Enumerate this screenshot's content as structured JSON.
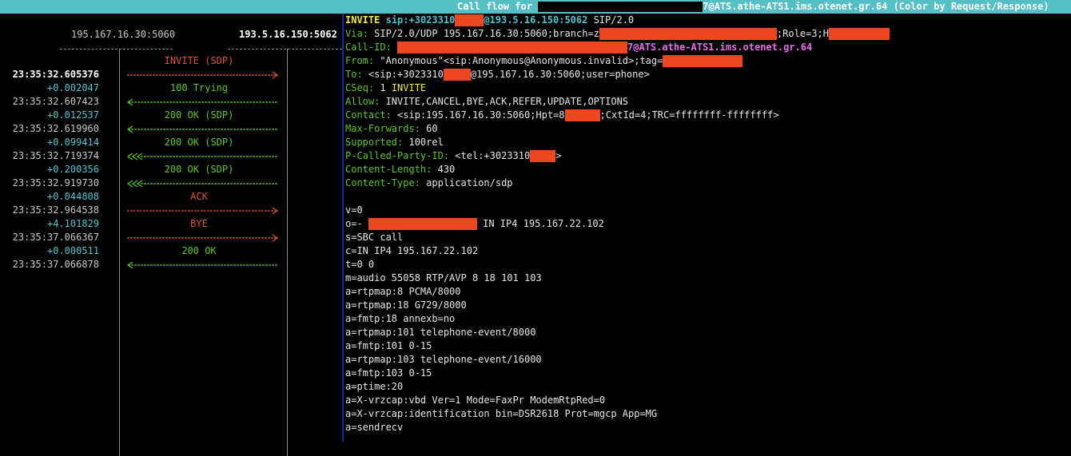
{
  "title": {
    "prefix": "Call flow for ",
    "suffix": "7@ATS.athe-ATS1.ims.otenet.gr.64 (Color by Request/Response)"
  },
  "hosts": {
    "left": "195.167.16.30:5060",
    "right": "193.5.16.150:5062"
  },
  "colors": {
    "title_bg": "#56bec5",
    "request": "#d9553a",
    "response": "#5ec42c",
    "delta": "#4fc3cf",
    "header_name": "#5ec42c",
    "method": "#f3e84a",
    "uri": "#4fc3cf",
    "callid": "#e86de8",
    "redaction": "#ec4820",
    "divider": "#1c2a8c"
  },
  "flow": [
    {
      "timestamp": "23:35:32.605376",
      "selected": true,
      "label": "INVITE (SDP)",
      "kind": "request",
      "direction": "right",
      "retrans": false,
      "delta": "+0.002047"
    },
    {
      "timestamp": "23:35:32.607423",
      "selected": false,
      "label": "100 Trying",
      "kind": "response",
      "direction": "left",
      "retrans": false,
      "delta": "+0.012537"
    },
    {
      "timestamp": "23:35:32.619960",
      "selected": false,
      "label": "200 OK (SDP)",
      "kind": "response",
      "direction": "left",
      "retrans": false,
      "delta": "+0.099414"
    },
    {
      "timestamp": "23:35:32.719374",
      "selected": false,
      "label": "200 OK (SDP)",
      "kind": "response",
      "direction": "left",
      "retrans": true,
      "delta": "+0.200356"
    },
    {
      "timestamp": "23:35:32.919730",
      "selected": false,
      "label": "200 OK (SDP)",
      "kind": "response",
      "direction": "left",
      "retrans": true,
      "delta": "+0.044808"
    },
    {
      "timestamp": "23:35:32.964538",
      "selected": false,
      "label": "ACK",
      "kind": "request",
      "direction": "right",
      "retrans": false,
      "delta": "+4.101829"
    },
    {
      "timestamp": "23:35:37.066367",
      "selected": false,
      "label": "BYE",
      "kind": "request",
      "direction": "right",
      "retrans": false,
      "delta": "+0.000511"
    },
    {
      "timestamp": "23:35:37.066878",
      "selected": false,
      "label": "200 OK",
      "kind": "response",
      "direction": "left",
      "retrans": false,
      "delta": null
    }
  ],
  "message": {
    "request_line": {
      "method": "INVITE",
      "uri_prefix": "sip:+3023310",
      "uri_suffix": "@193.5.16.150:5062",
      "version": " SIP/2.0"
    },
    "via": {
      "name": "Via:",
      "value": " SIP/2.0/UDP 195.167.16.30:5060;branch=z",
      "mid": ";Role=3;H"
    },
    "call_id": {
      "name": "Call-ID:",
      "suffix": "7@ATS.athe-ATS1.ims.otenet.gr.64"
    },
    "from": {
      "name": "From:",
      "value": " \"Anonymous\"<sip:Anonymous@Anonymous.invalid>;tag="
    },
    "to": {
      "name": "To:",
      "value_prefix": " <sip:+3023310",
      "value_suffix": "@195.167.16.30:5060;user=phone>"
    },
    "cseq": {
      "name": "CSeq:",
      "num": " 1 ",
      "method": "INVITE"
    },
    "allow": {
      "name": "Allow:",
      "value": " INVITE,CANCEL,BYE,ACK,REFER,UPDATE,OPTIONS"
    },
    "contact": {
      "name": "Contact:",
      "value_prefix": " <sip:195.167.16.30:5060;Hpt=8",
      "value_suffix": ";CxtId=4;TRC=ffffffff-ffffffff>"
    },
    "max_forwards": {
      "name": "Max-Forwards:",
      "value": " 60"
    },
    "supported": {
      "name": "Supported:",
      "value": " 100rel"
    },
    "p_called": {
      "name": "P-Called-Party-ID:",
      "value_prefix": " <tel:+3023310",
      "value_suffix": ">"
    },
    "content_length": {
      "name": "Content-Length:",
      "value": " 430"
    },
    "content_type": {
      "name": "Content-Type:",
      "value": " application/sdp"
    },
    "sdp": {
      "v": "v=0",
      "o_prefix": "o=- ",
      "o_suffix": " IN IP4 195.167.22.102",
      "lines": [
        "s=SBC call",
        "c=IN IP4 195.167.22.102",
        "t=0 0",
        "m=audio 55058 RTP/AVP 8 18 101 103",
        "a=rtpmap:8 PCMA/8000",
        "a=rtpmap:18 G729/8000",
        "a=fmtp:18 annexb=no",
        "a=rtpmap:101 telephone-event/8000",
        "a=fmtp:101 0-15",
        "a=rtpmap:103 telephone-event/16000",
        "a=fmtp:103 0-15",
        "a=ptime:20",
        "a=X-vrzcap:vbd Ver=1 Mode=FaxPr ModemRtpRed=0",
        "a=X-vrzcap:identification bin=DSR2618 Prot=mgcp App=MG",
        "a=sendrecv"
      ]
    }
  }
}
